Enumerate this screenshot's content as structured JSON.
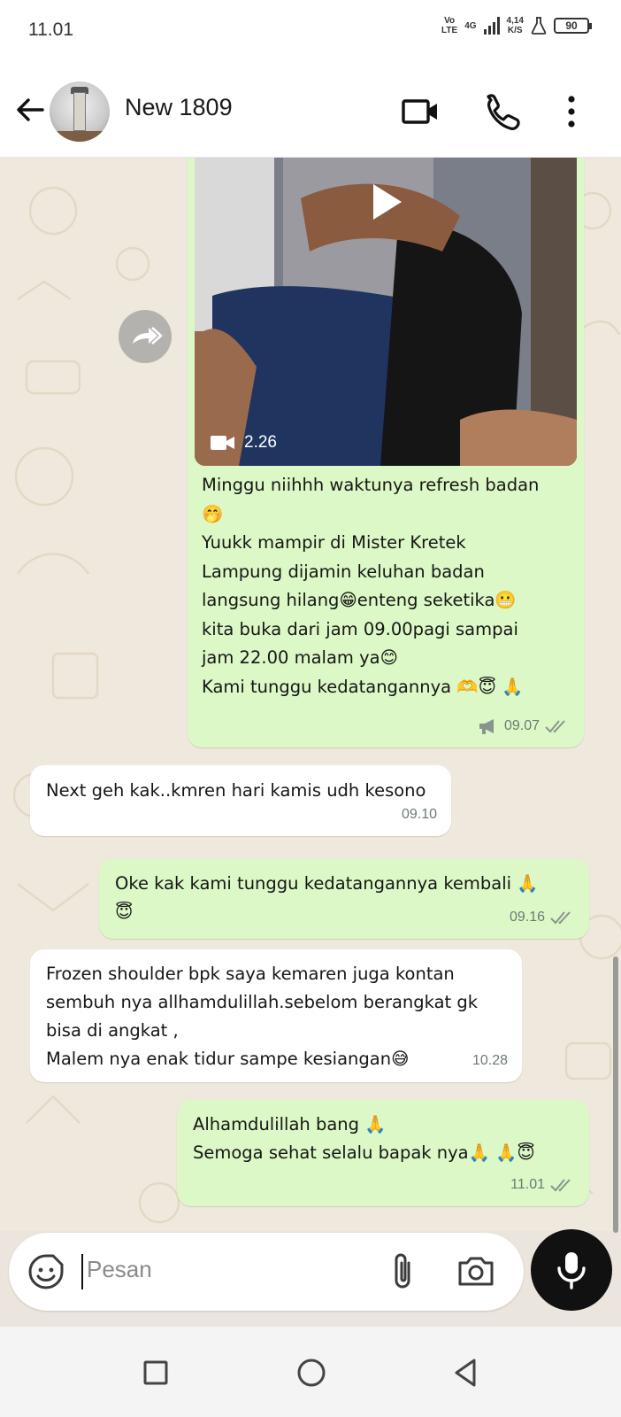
{
  "status_bar": {
    "time": "11.01",
    "network_top": "Vo",
    "network_bottom": "LTE",
    "gen": "4G",
    "speed_top": "4,14",
    "speed_bottom": "K/S",
    "battery": "90"
  },
  "header": {
    "contact_name": "New 1809",
    "icons": [
      "back-arrow-icon",
      "video-call-icon",
      "voice-call-icon",
      "more-vertical-icon"
    ]
  },
  "messages": [
    {
      "direction": "out",
      "video_duration": "2.26",
      "lines": [
        "Minggu niihhh waktunya refresh badan",
        "🤭",
        "Yuukk mampir di Mister Kretek",
        "Lampung dijamin keluhan badan",
        "langsung hilang😁enteng seketika😬",
        "kita buka dari jam 09.00pagi sampai",
        "jam 22.00 malam ya😊",
        "Kami tunggu kedatangannya 🫶😇 🙏"
      ],
      "time": "09.07",
      "broadcast_icon": "megaphone-icon"
    },
    {
      "direction": "in",
      "lines": [
        "Next geh kak..kmren hari kamis udh kesono"
      ],
      "time": "09.10"
    },
    {
      "direction": "out",
      "lines": [
        "Oke kak kami tunggu kedatangannya kembali 🙏",
        "😇"
      ],
      "time": "09.16"
    },
    {
      "direction": "in",
      "lines": [
        "Frozen shoulder bpk saya kemaren juga kontan",
        "sembuh nya allhamdulillah.sebelom berangkat gk",
        "bisa di angkat  ,",
        "Malem nya enak tidur sampe kesiangan😅"
      ],
      "time": "10.28"
    },
    {
      "direction": "out",
      "lines": [
        "Alhamdulillah bang 🙏",
        "Semoga sehat selalu bapak nya🙏 🙏😇"
      ],
      "time": "11.01"
    }
  ],
  "composer": {
    "placeholder": "Pesan"
  },
  "colors": {
    "outgoing_bubble": "#dcf8c6",
    "incoming_bubble": "#ffffff",
    "background": "#efe8dc"
  }
}
